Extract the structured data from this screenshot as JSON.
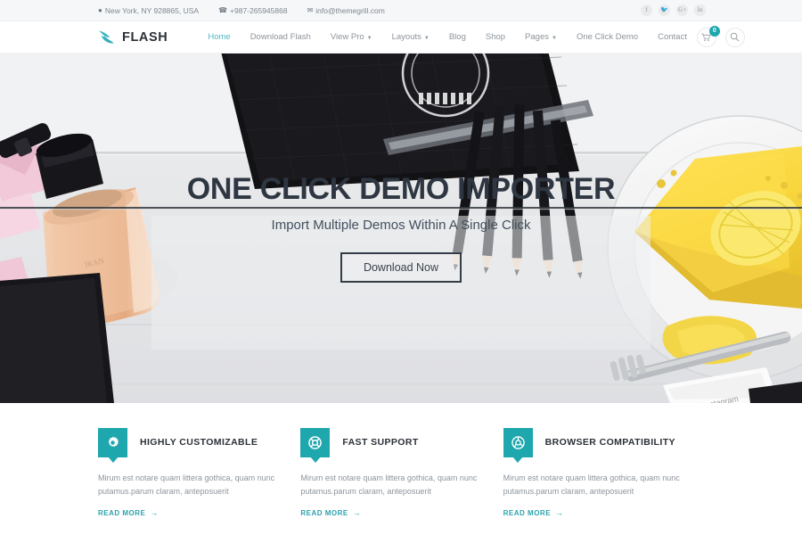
{
  "topbar": {
    "address": "New York, NY 928865, USA",
    "phone": "+987-265945868",
    "email": "info@themegrill.com",
    "socials": [
      {
        "name": "facebook",
        "glyph": "f"
      },
      {
        "name": "twitter",
        "glyph": "t"
      },
      {
        "name": "google-plus",
        "glyph": "G+"
      },
      {
        "name": "linkedin",
        "glyph": "in"
      }
    ]
  },
  "header": {
    "brand": "FLASH",
    "nav": [
      {
        "label": "Home",
        "active": true,
        "caret": false
      },
      {
        "label": "Download Flash",
        "active": false,
        "caret": false
      },
      {
        "label": "View Pro",
        "active": false,
        "caret": true
      },
      {
        "label": "Layouts",
        "active": false,
        "caret": true
      },
      {
        "label": "Blog",
        "active": false,
        "caret": false
      },
      {
        "label": "Shop",
        "active": false,
        "caret": false
      },
      {
        "label": "Pages",
        "active": false,
        "caret": true
      },
      {
        "label": "One Click Demo",
        "active": false,
        "caret": false
      },
      {
        "label": "Contact",
        "active": false,
        "caret": false
      }
    ],
    "cart_count": "0"
  },
  "hero": {
    "title": "ONE CLICK DEMO IMPORTER",
    "subtitle": "Import Multiple Demos Within A Single Click",
    "button": "Download Now"
  },
  "features": [
    {
      "icon": "gear-icon",
      "title": "HIGHLY CUSTOMIZABLE",
      "text": "Mirum est notare quam littera gothica, quam nunc putamus.parum claram, anteposuerit",
      "link": "READ MORE"
    },
    {
      "icon": "lifebuoy-icon",
      "title": "FAST SUPPORT",
      "text": "Mirum est notare quam littera gothica, quam nunc putamus.parum claram, anteposuerit",
      "link": "READ MORE"
    },
    {
      "icon": "chrome-icon",
      "title": "BROWSER COMPATIBILITY",
      "text": "Mirum est notare quam littera gothica, quam nunc putamus.parum claram, anteposuerit",
      "link": "READ MORE"
    }
  ],
  "colors": {
    "accent": "#1fa7ae",
    "nav_active": "#4fb8c4",
    "heading": "#2b3038",
    "body_text": "#8d949b",
    "topbar_bg": "#f6f7f8"
  }
}
